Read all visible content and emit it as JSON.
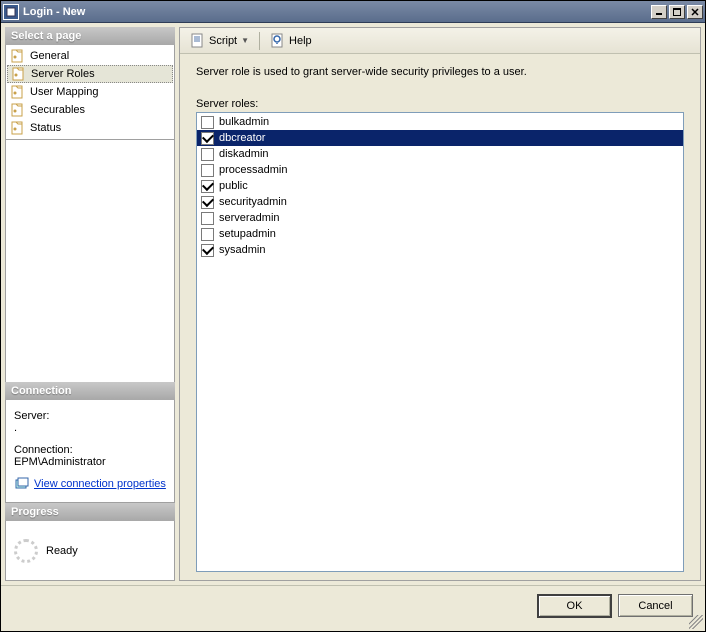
{
  "window": {
    "title": "Login - New"
  },
  "sidebar": {
    "select_page_label": "Select a page",
    "pages": [
      {
        "label": "General",
        "selected": false
      },
      {
        "label": "Server Roles",
        "selected": true
      },
      {
        "label": "User Mapping",
        "selected": false
      },
      {
        "label": "Securables",
        "selected": false
      },
      {
        "label": "Status",
        "selected": false
      }
    ],
    "connection_header": "Connection",
    "server_label": "Server:",
    "server_value": ".",
    "connection_label": "Connection:",
    "connection_value": "EPM\\Administrator",
    "view_props_link": "View connection properties",
    "progress_header": "Progress",
    "progress_status": "Ready"
  },
  "toolbar": {
    "script_label": "Script",
    "help_label": "Help"
  },
  "main": {
    "description": "Server role is used to grant server-wide security privileges to a user.",
    "roles_label": "Server roles:",
    "roles": [
      {
        "name": "bulkadmin",
        "checked": false,
        "selected": false
      },
      {
        "name": "dbcreator",
        "checked": true,
        "selected": true
      },
      {
        "name": "diskadmin",
        "checked": false,
        "selected": false
      },
      {
        "name": "processadmin",
        "checked": false,
        "selected": false
      },
      {
        "name": "public",
        "checked": true,
        "selected": false
      },
      {
        "name": "securityadmin",
        "checked": true,
        "selected": false
      },
      {
        "name": "serveradmin",
        "checked": false,
        "selected": false
      },
      {
        "name": "setupadmin",
        "checked": false,
        "selected": false
      },
      {
        "name": "sysadmin",
        "checked": true,
        "selected": false
      }
    ]
  },
  "buttons": {
    "ok": "OK",
    "cancel": "Cancel"
  }
}
